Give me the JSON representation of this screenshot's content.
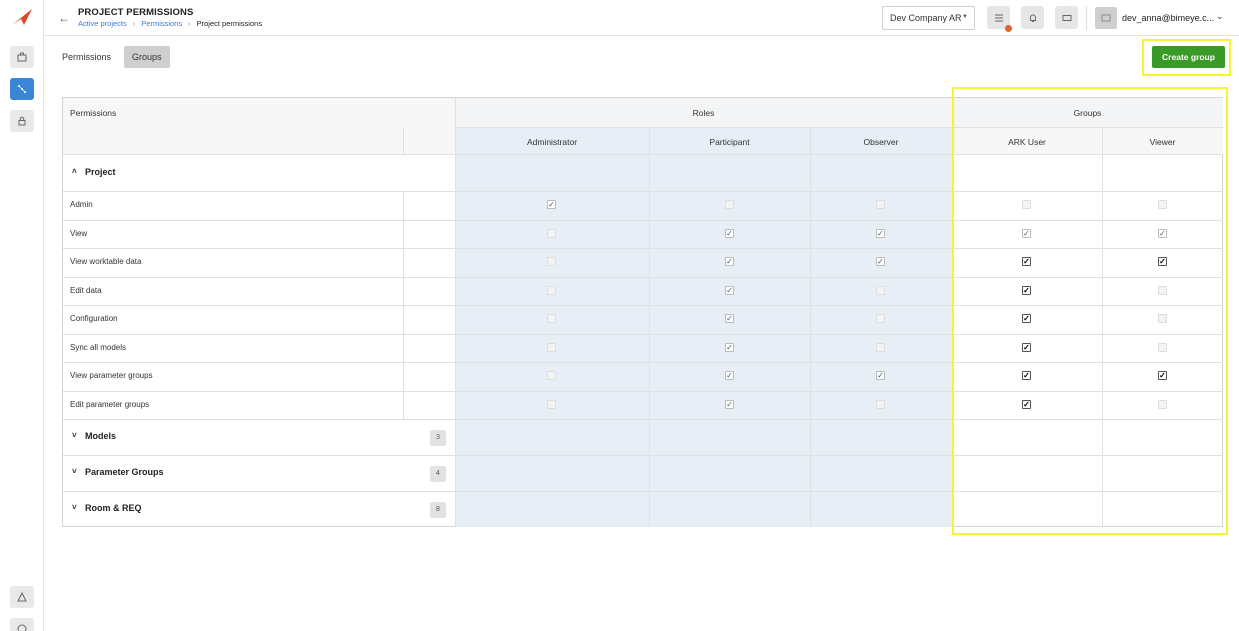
{
  "header": {
    "title": "PROJECT PERMISSIONS",
    "breadcrumb": [
      "Active projects",
      "Permissions",
      "Project permissions"
    ],
    "company": "Dev Company AR",
    "user": "dev_anna@bimeye.c..."
  },
  "tabs": [
    {
      "label": "Permissions",
      "active": false
    },
    {
      "label": "Groups",
      "active": true
    }
  ],
  "create_group_label": "Create group",
  "table": {
    "permissions_header": "Permissions",
    "roles_header": "Roles",
    "groups_header": "Groups",
    "columns": [
      "Administrator",
      "Participant",
      "Observer",
      "ARK User",
      "Viewer"
    ],
    "sections": [
      {
        "label": "Project",
        "expanded": true,
        "count": ""
      },
      {
        "label": "Models",
        "expanded": false,
        "count": "3"
      },
      {
        "label": "Parameter Groups",
        "expanded": false,
        "count": "4"
      },
      {
        "label": "Room & REQ",
        "expanded": false,
        "count": "8"
      }
    ],
    "rows": [
      {
        "label": "Admin",
        "values": [
          1,
          0,
          0,
          0,
          0
        ]
      },
      {
        "label": "View",
        "values": [
          0,
          1,
          1,
          1,
          1
        ]
      },
      {
        "label": "View worktable data",
        "values": [
          0,
          1,
          1,
          2,
          2
        ]
      },
      {
        "label": "Edit data",
        "values": [
          0,
          1,
          0,
          2,
          0
        ]
      },
      {
        "label": "Configuration",
        "values": [
          0,
          1,
          0,
          2,
          0
        ]
      },
      {
        "label": "Sync all models",
        "values": [
          0,
          1,
          0,
          2,
          0
        ]
      },
      {
        "label": "View parameter groups",
        "values": [
          0,
          1,
          1,
          2,
          2
        ]
      },
      {
        "label": "Edit parameter groups",
        "values": [
          0,
          1,
          0,
          2,
          0
        ]
      }
    ]
  },
  "colors": {
    "accent": "#3a85d6",
    "create": "#3a9a28",
    "highlight": "#f5f536",
    "roles_bg": "#e7eef6"
  }
}
